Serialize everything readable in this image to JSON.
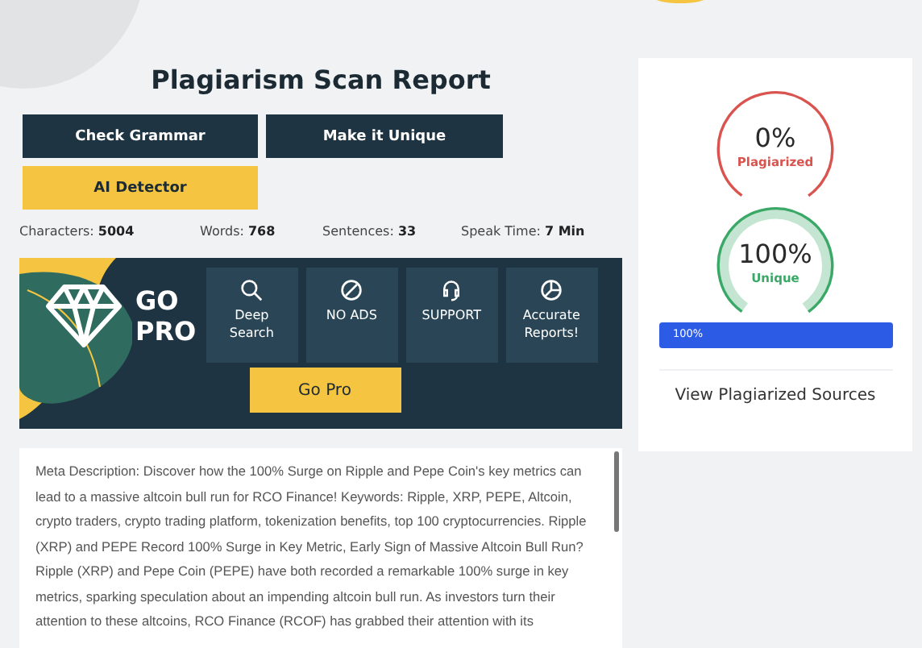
{
  "title": "Plagiarism Scan Report",
  "actions": [
    {
      "label": "Check Grammar",
      "kind": "dark"
    },
    {
      "label": "Make it Unique",
      "kind": "dark"
    },
    {
      "label": "AI Detector",
      "kind": "accent"
    }
  ],
  "stats": [
    {
      "label": "Characters:",
      "value": "5004"
    },
    {
      "label": "Words:",
      "value": "768"
    },
    {
      "label": "Sentences:",
      "value": "33"
    },
    {
      "label": "Speak Time:",
      "value": "7 Min"
    }
  ],
  "promo": {
    "heading_1": "GO",
    "heading_2": "PRO",
    "features": [
      {
        "kind": "search",
        "label": "Deep Search"
      },
      {
        "kind": "noads",
        "label": "NO ADS"
      },
      {
        "kind": "support",
        "label": "SUPPORT"
      },
      {
        "kind": "reports",
        "label": "Accurate Reports!"
      }
    ],
    "button": "Go Pro"
  },
  "content": "Meta Description: Discover how the 100% Surge on Ripple and Pepe Coin's key metrics can lead to a massive altcoin bull run for RCO Finance! Keywords: Ripple, XRP, PEPE, Altcoin, crypto traders, crypto trading platform, tokenization benefits, top 100 cryptocurrencies. Ripple (XRP) and PEPE Record 100% Surge in Key Metric, Early Sign of Massive Altcoin Bull Run? Ripple (XRP) and Pepe Coin (PEPE) have both recorded a remarkable 100% surge in key metrics, sparking speculation about an impending altcoin bull run. As investors turn their attention to these altcoins, RCO Finance (RCOF) has grabbed their attention with its",
  "results": {
    "gauges": [
      {
        "value": "0%",
        "label": "Plagiarized",
        "color": "#d9534f",
        "kind": "plain"
      },
      {
        "value": "100%",
        "label": "Unique",
        "color": "#3aa866",
        "kind": "ringed"
      }
    ],
    "progress": {
      "level": 1,
      "label": "100%"
    },
    "sources_link": "View Plagiarized Sources"
  }
}
